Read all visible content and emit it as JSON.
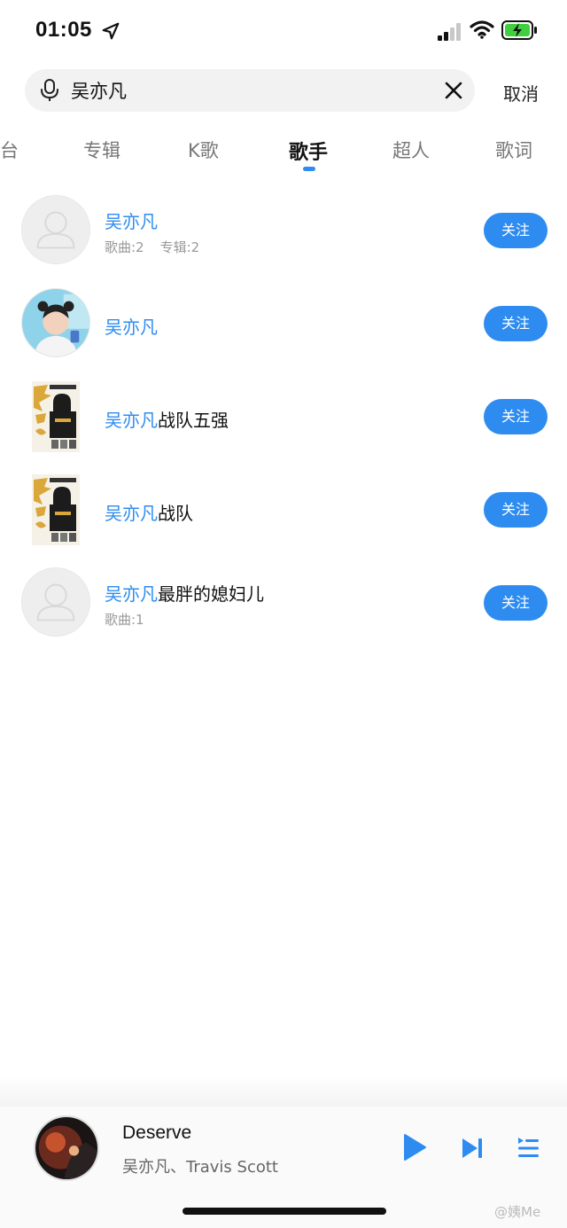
{
  "status_bar": {
    "time": "01:05"
  },
  "search": {
    "query": "吴亦凡",
    "cancel_label": "取消"
  },
  "tabs": [
    {
      "label": "台"
    },
    {
      "label": "专辑"
    },
    {
      "label": "K歌"
    },
    {
      "label": "歌手",
      "active": true
    },
    {
      "label": "超人"
    },
    {
      "label": "歌词"
    }
  ],
  "results": [
    {
      "name_highlight": "吴亦凡",
      "name_rest": "",
      "meta": [
        "歌曲:2",
        "专辑:2"
      ],
      "avatar": "default-avatar",
      "follow_label": "关注"
    },
    {
      "name_highlight": "吴亦凡",
      "name_rest": "",
      "meta": [],
      "avatar": "photo-girl",
      "follow_label": "关注"
    },
    {
      "name_highlight": "吴亦凡",
      "name_rest": "战队五强",
      "meta": [],
      "avatar": "poster",
      "follow_label": "关注"
    },
    {
      "name_highlight": "吴亦凡",
      "name_rest": "战队",
      "meta": [],
      "avatar": "poster",
      "follow_label": "关注"
    },
    {
      "name_highlight": "吴亦凡",
      "name_rest": "最胖的媳妇儿",
      "meta": [
        "歌曲:1"
      ],
      "avatar": "default-avatar",
      "follow_label": "关注"
    }
  ],
  "player": {
    "title": "Deserve",
    "artist": "吴亦凡、Travis Scott",
    "watermark": "@姨Me"
  },
  "colors": {
    "accent": "#2e8cf0",
    "text_primary": "#111111",
    "text_secondary": "#999999"
  }
}
